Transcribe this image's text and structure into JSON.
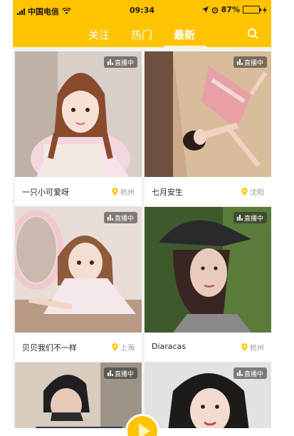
{
  "status": {
    "carrier": "中国电信",
    "time": "09:34",
    "battery": "87%",
    "battery_level": 0.87
  },
  "tabs": [
    {
      "label": "关注"
    },
    {
      "label": "热门"
    },
    {
      "label": "最新"
    }
  ],
  "active_tab": "最新",
  "badge_label": "直播中",
  "cards": [
    {
      "name": "一只小可爱呀",
      "city": "杭州"
    },
    {
      "name": "七月安生",
      "city": "沈阳"
    },
    {
      "name": "贝贝我们不一样",
      "city": "上海"
    },
    {
      "name": "Diaracas",
      "city": "杭州"
    },
    {
      "name": "",
      "city": ""
    },
    {
      "name": "",
      "city": ""
    }
  ],
  "colors": {
    "accent": "#ffc300",
    "live_badge_bg": "#282828"
  },
  "icons": [
    "signal-icon",
    "wifi-icon",
    "location-arrow-icon",
    "alarm-icon",
    "battery-icon",
    "charging-icon",
    "search-icon",
    "live-bars-icon",
    "location-pin-icon",
    "play-icon"
  ]
}
